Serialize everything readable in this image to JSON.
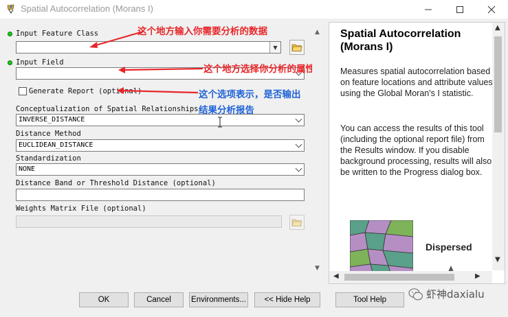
{
  "window": {
    "title": "Spatial Autocorrelation (Morans I)"
  },
  "form": {
    "input_feature_class": {
      "label": "Input Feature Class",
      "value": ""
    },
    "input_field": {
      "label": "Input Field",
      "value": ""
    },
    "generate_report": {
      "label": "Generate Report (optional)",
      "checked": false
    },
    "conceptualization": {
      "label": "Conceptualization of Spatial Relationships",
      "value": "INVERSE_DISTANCE"
    },
    "distance_method": {
      "label": "Distance Method",
      "value": "EUCLIDEAN_DISTANCE"
    },
    "standardization": {
      "label": "Standardization",
      "value": "NONE"
    },
    "distance_band": {
      "label": "Distance Band or Threshold Distance (optional)",
      "value": ""
    },
    "weights_matrix": {
      "label": "Weights Matrix File (optional)",
      "value": ""
    }
  },
  "annotations": {
    "input_feature_class": "这个地方输入你需要分析的数据",
    "input_field": "这个地方选择你分析的属性",
    "generate_report_line1": "这个选项表示，是否输出",
    "generate_report_line2": "结果分析报告"
  },
  "help": {
    "title": "Spatial Autocorrelation (Morans I)",
    "para1": "Measures spatial autocorrelation based on feature locations and attribute values using the Global Moran's I statistic.",
    "para2": "You can access the results of this tool (including the optional report file) from the Results window. If you disable background processing, results will also be written to the Progress dialog box.",
    "image_caption": "Dispersed"
  },
  "buttons": {
    "ok": "OK",
    "cancel": "Cancel",
    "environments": "Environments...",
    "hide_help": "<< Hide Help",
    "tool_help": "Tool Help"
  },
  "watermark": "虾神daxialu",
  "colors": {
    "annotation_red": "#e8262a",
    "annotation_blue": "#1f63d8",
    "required_dot": "#1ec41e"
  }
}
